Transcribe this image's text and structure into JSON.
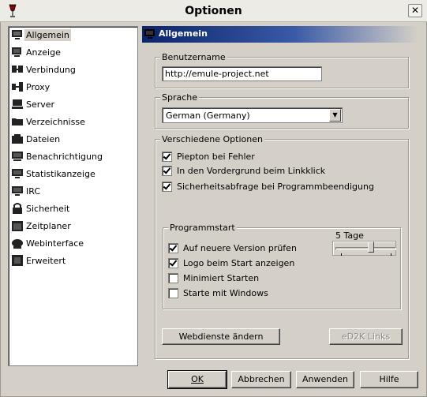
{
  "window": {
    "title": "Optionen",
    "close_glyph": "✕",
    "app_icon": "wine-glass-icon"
  },
  "sidebar": {
    "items": [
      {
        "label": "Allgemein",
        "icon": "general-icon",
        "selected": true
      },
      {
        "label": "Anzeige",
        "icon": "display-icon"
      },
      {
        "label": "Verbindung",
        "icon": "connection-icon"
      },
      {
        "label": "Proxy",
        "icon": "proxy-icon"
      },
      {
        "label": "Server",
        "icon": "server-icon"
      },
      {
        "label": "Verzeichnisse",
        "icon": "folders-icon"
      },
      {
        "label": "Dateien",
        "icon": "files-icon"
      },
      {
        "label": "Benachrichtigung",
        "icon": "notification-icon"
      },
      {
        "label": "Statistikanzeige",
        "icon": "statistics-icon"
      },
      {
        "label": "IRC",
        "icon": "irc-icon"
      },
      {
        "label": "Sicherheit",
        "icon": "security-icon"
      },
      {
        "label": "Zeitplaner",
        "icon": "scheduler-icon"
      },
      {
        "label": "Webinterface",
        "icon": "web-icon"
      },
      {
        "label": "Erweitert",
        "icon": "advanced-icon"
      }
    ]
  },
  "panel": {
    "header": "Allgemein",
    "username": {
      "legend": "Benutzername",
      "value": "http://emule-project.net"
    },
    "language": {
      "legend": "Sprache",
      "selected": "German (Germany)"
    },
    "misc": {
      "legend": "Verschiedene Optionen",
      "options": [
        {
          "label": "Piepton bei Fehler",
          "checked": true
        },
        {
          "label": "In den Vordergrund beim Linkklick",
          "checked": true
        },
        {
          "label": "Sicherheitsabfrage bei Programmbeendigung",
          "checked": true
        }
      ]
    },
    "startup": {
      "legend": "Programmstart",
      "slider_label": "5 Tage",
      "slider_fraction": 0.6,
      "options": [
        {
          "label": "Auf neuere Version prüfen",
          "checked": true
        },
        {
          "label": "Logo beim Start anzeigen",
          "checked": true
        },
        {
          "label": "Minimiert Starten",
          "checked": false
        },
        {
          "label": "Starte mit Windows",
          "checked": false
        }
      ]
    },
    "buttons": {
      "webservices": "Webdienste ändern",
      "ed2k": "eD2K Links"
    }
  },
  "footer": {
    "ok": "OK",
    "cancel": "Abbrechen",
    "apply": "Anwenden",
    "help": "Hilfe"
  }
}
